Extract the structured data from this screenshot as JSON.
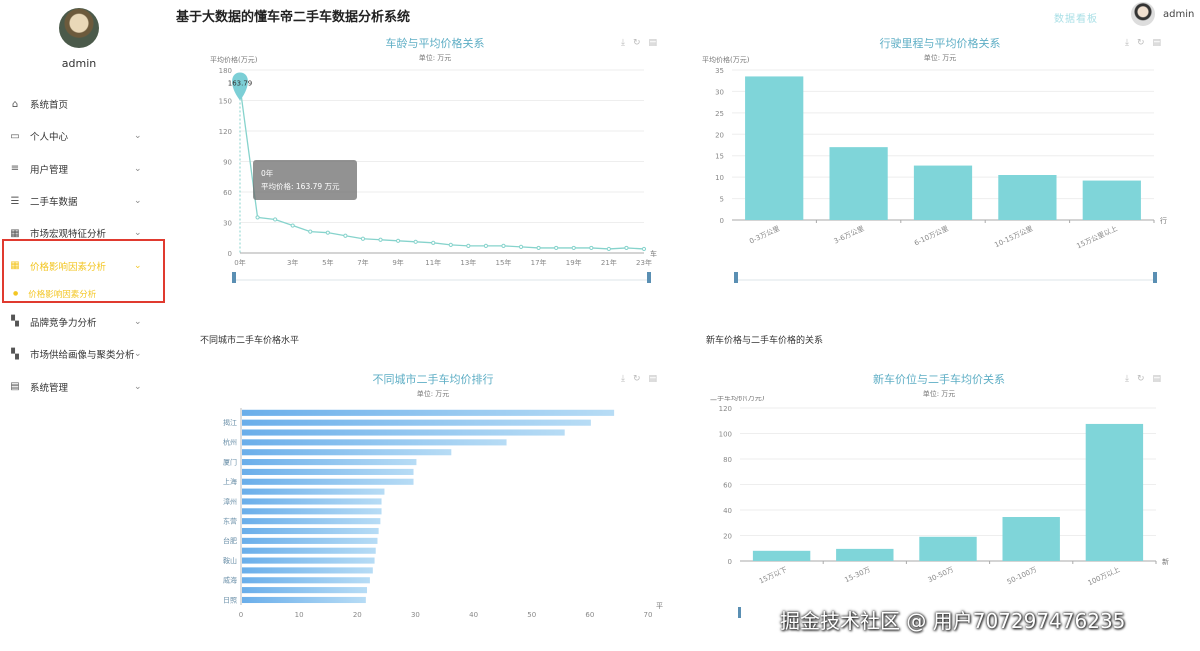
{
  "app": {
    "title": "基于大数据的懂车帝二手车数据分析系统",
    "header_link": "数据看板",
    "user": "admin"
  },
  "sidebar": {
    "username": "admin",
    "items": [
      {
        "label": "系统首页",
        "icon": "home-icon",
        "glyph": "⌂",
        "chevron": false
      },
      {
        "label": "个人中心",
        "icon": "profile-icon",
        "glyph": "▭",
        "chevron": true
      },
      {
        "label": "用户管理",
        "icon": "list-icon",
        "glyph": "≡",
        "chevron": true
      },
      {
        "label": "二手车数据",
        "icon": "sliders-icon",
        "glyph": "☰",
        "chevron": true
      },
      {
        "label": "市场宏观特征分析",
        "icon": "grid-icon",
        "glyph": "▦",
        "chevron": true
      },
      {
        "label": "价格影响因素分析",
        "icon": "grid-icon",
        "glyph": "▦",
        "chevron": true,
        "active": true
      },
      {
        "label": "品牌竞争力分析",
        "icon": "apps-icon",
        "glyph": "▚",
        "chevron": true
      },
      {
        "label": "市场供给画像与聚类分析",
        "icon": "apps-icon",
        "glyph": "▚",
        "chevron": true
      },
      {
        "label": "系统管理",
        "icon": "clipboard-icon",
        "glyph": "▤",
        "chevron": true
      }
    ],
    "submenu": [
      "价格影响因素分析"
    ]
  },
  "panels": {
    "age": {
      "title": "车龄与平均价格关系",
      "unit": "单位: 万元"
    },
    "mileage": {
      "title": "行驶里程与平均价格关系",
      "unit": "单位: 万元"
    },
    "city_heading": "不同城市二手车价格水平",
    "city": {
      "title": "不同城市二手车均价排行",
      "unit": "单位: 万元"
    },
    "newprice_heading": "新车价格与二手车价格的关系",
    "newprice": {
      "title": "新车价位与二手车均价关系",
      "unit": "单位: 万元"
    }
  },
  "tooltip": {
    "line1": "0年",
    "line2": "平均价格: 163.79 万元"
  },
  "watermark": "掘金技术社区 @ 用户707297476235",
  "colors": {
    "bar": "#7fd5d9",
    "line": "#86d3cc",
    "accent": "#f3c623",
    "highlight": "#e03a2f"
  },
  "chart_data": [
    {
      "type": "line",
      "title": "车龄与平均价格关系",
      "ylabel": "平均价格(万元)",
      "xlabel": "车",
      "x": [
        "0年",
        "1年",
        "2年",
        "3年",
        "4年",
        "5年",
        "6年",
        "7年",
        "8年",
        "9年",
        "10年",
        "11年",
        "12年",
        "13年",
        "14年",
        "15年",
        "16年",
        "17年",
        "18年",
        "19年",
        "20年",
        "21年",
        "22年",
        "23年"
      ],
      "xticks": [
        "0年",
        "3年",
        "5年",
        "7年",
        "9年",
        "11年",
        "13年",
        "15年",
        "17年",
        "19年",
        "21年",
        "23年"
      ],
      "values": [
        163.79,
        35,
        33,
        27,
        21,
        20,
        17,
        14,
        13,
        12,
        11,
        10,
        8,
        7,
        7,
        7,
        6,
        5,
        5,
        5,
        5,
        4,
        5,
        4
      ],
      "ylim": [
        0,
        180
      ],
      "yticks": [
        0,
        30,
        60,
        90,
        120,
        150,
        180
      ],
      "marker_label": "163.79"
    },
    {
      "type": "bar",
      "title": "行驶里程与平均价格关系",
      "ylabel": "平均价格(万元)",
      "xlabel": "行",
      "categories": [
        "0-3万公里",
        "3-6万公里",
        "6-10万公里",
        "10-15万公里",
        "15万公里以上"
      ],
      "values": [
        33.5,
        17,
        12.7,
        10.5,
        9.2
      ],
      "ylim": [
        0,
        35
      ],
      "yticks": [
        0,
        5,
        10,
        15,
        20,
        25,
        30,
        35
      ]
    },
    {
      "type": "bar",
      "orientation": "horizontal",
      "title": "不同城市二手车均价排行",
      "xlabel": "平",
      "categories": [
        "",
        "揭江",
        "",
        "杭州",
        "",
        "厦门",
        "",
        "上海",
        "",
        "漳州",
        "",
        "东营",
        "",
        "台肥",
        "",
        "鞍山",
        "",
        "威海",
        "",
        "日照"
      ],
      "values": [
        64,
        60,
        55.5,
        45.5,
        36,
        30,
        29.5,
        29.5,
        24.5,
        24,
        24,
        23.8,
        23.5,
        23.3,
        23,
        22.8,
        22.5,
        22,
        21.5,
        21.3
      ],
      "xlim": [
        0,
        70
      ],
      "xticks": [
        0,
        10,
        20,
        30,
        40,
        50,
        60,
        70
      ]
    },
    {
      "type": "bar",
      "title": "新车价位与二手车均价关系",
      "ylabel": "二手车均价(万元)",
      "xlabel": "新",
      "categories": [
        "15万以下",
        "15-30万",
        "30-50万",
        "50-100万",
        "100万以上"
      ],
      "values": [
        8,
        9.5,
        19,
        34.5,
        107.5
      ],
      "ylim": [
        0,
        120
      ],
      "yticks": [
        0,
        20,
        40,
        60,
        80,
        100,
        120
      ]
    }
  ]
}
